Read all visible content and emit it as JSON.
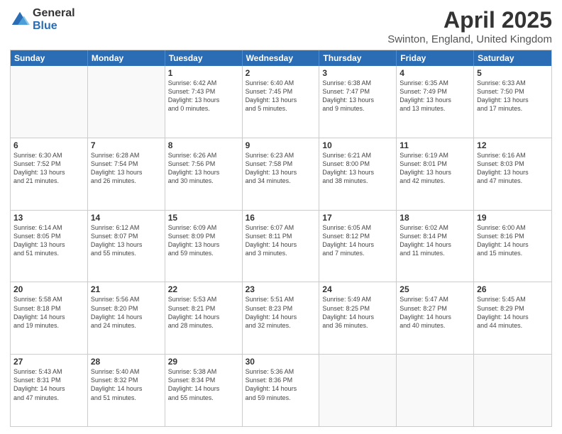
{
  "logo": {
    "general": "General",
    "blue": "Blue"
  },
  "header": {
    "month": "April 2025",
    "location": "Swinton, England, United Kingdom"
  },
  "days_of_week": [
    "Sunday",
    "Monday",
    "Tuesday",
    "Wednesday",
    "Thursday",
    "Friday",
    "Saturday"
  ],
  "weeks": [
    [
      {
        "day": "",
        "info": ""
      },
      {
        "day": "",
        "info": ""
      },
      {
        "day": "1",
        "info": "Sunrise: 6:42 AM\nSunset: 7:43 PM\nDaylight: 13 hours\nand 0 minutes."
      },
      {
        "day": "2",
        "info": "Sunrise: 6:40 AM\nSunset: 7:45 PM\nDaylight: 13 hours\nand 5 minutes."
      },
      {
        "day": "3",
        "info": "Sunrise: 6:38 AM\nSunset: 7:47 PM\nDaylight: 13 hours\nand 9 minutes."
      },
      {
        "day": "4",
        "info": "Sunrise: 6:35 AM\nSunset: 7:49 PM\nDaylight: 13 hours\nand 13 minutes."
      },
      {
        "day": "5",
        "info": "Sunrise: 6:33 AM\nSunset: 7:50 PM\nDaylight: 13 hours\nand 17 minutes."
      }
    ],
    [
      {
        "day": "6",
        "info": "Sunrise: 6:30 AM\nSunset: 7:52 PM\nDaylight: 13 hours\nand 21 minutes."
      },
      {
        "day": "7",
        "info": "Sunrise: 6:28 AM\nSunset: 7:54 PM\nDaylight: 13 hours\nand 26 minutes."
      },
      {
        "day": "8",
        "info": "Sunrise: 6:26 AM\nSunset: 7:56 PM\nDaylight: 13 hours\nand 30 minutes."
      },
      {
        "day": "9",
        "info": "Sunrise: 6:23 AM\nSunset: 7:58 PM\nDaylight: 13 hours\nand 34 minutes."
      },
      {
        "day": "10",
        "info": "Sunrise: 6:21 AM\nSunset: 8:00 PM\nDaylight: 13 hours\nand 38 minutes."
      },
      {
        "day": "11",
        "info": "Sunrise: 6:19 AM\nSunset: 8:01 PM\nDaylight: 13 hours\nand 42 minutes."
      },
      {
        "day": "12",
        "info": "Sunrise: 6:16 AM\nSunset: 8:03 PM\nDaylight: 13 hours\nand 47 minutes."
      }
    ],
    [
      {
        "day": "13",
        "info": "Sunrise: 6:14 AM\nSunset: 8:05 PM\nDaylight: 13 hours\nand 51 minutes."
      },
      {
        "day": "14",
        "info": "Sunrise: 6:12 AM\nSunset: 8:07 PM\nDaylight: 13 hours\nand 55 minutes."
      },
      {
        "day": "15",
        "info": "Sunrise: 6:09 AM\nSunset: 8:09 PM\nDaylight: 13 hours\nand 59 minutes."
      },
      {
        "day": "16",
        "info": "Sunrise: 6:07 AM\nSunset: 8:11 PM\nDaylight: 14 hours\nand 3 minutes."
      },
      {
        "day": "17",
        "info": "Sunrise: 6:05 AM\nSunset: 8:12 PM\nDaylight: 14 hours\nand 7 minutes."
      },
      {
        "day": "18",
        "info": "Sunrise: 6:02 AM\nSunset: 8:14 PM\nDaylight: 14 hours\nand 11 minutes."
      },
      {
        "day": "19",
        "info": "Sunrise: 6:00 AM\nSunset: 8:16 PM\nDaylight: 14 hours\nand 15 minutes."
      }
    ],
    [
      {
        "day": "20",
        "info": "Sunrise: 5:58 AM\nSunset: 8:18 PM\nDaylight: 14 hours\nand 19 minutes."
      },
      {
        "day": "21",
        "info": "Sunrise: 5:56 AM\nSunset: 8:20 PM\nDaylight: 14 hours\nand 24 minutes."
      },
      {
        "day": "22",
        "info": "Sunrise: 5:53 AM\nSunset: 8:21 PM\nDaylight: 14 hours\nand 28 minutes."
      },
      {
        "day": "23",
        "info": "Sunrise: 5:51 AM\nSunset: 8:23 PM\nDaylight: 14 hours\nand 32 minutes."
      },
      {
        "day": "24",
        "info": "Sunrise: 5:49 AM\nSunset: 8:25 PM\nDaylight: 14 hours\nand 36 minutes."
      },
      {
        "day": "25",
        "info": "Sunrise: 5:47 AM\nSunset: 8:27 PM\nDaylight: 14 hours\nand 40 minutes."
      },
      {
        "day": "26",
        "info": "Sunrise: 5:45 AM\nSunset: 8:29 PM\nDaylight: 14 hours\nand 44 minutes."
      }
    ],
    [
      {
        "day": "27",
        "info": "Sunrise: 5:43 AM\nSunset: 8:31 PM\nDaylight: 14 hours\nand 47 minutes."
      },
      {
        "day": "28",
        "info": "Sunrise: 5:40 AM\nSunset: 8:32 PM\nDaylight: 14 hours\nand 51 minutes."
      },
      {
        "day": "29",
        "info": "Sunrise: 5:38 AM\nSunset: 8:34 PM\nDaylight: 14 hours\nand 55 minutes."
      },
      {
        "day": "30",
        "info": "Sunrise: 5:36 AM\nSunset: 8:36 PM\nDaylight: 14 hours\nand 59 minutes."
      },
      {
        "day": "",
        "info": ""
      },
      {
        "day": "",
        "info": ""
      },
      {
        "day": "",
        "info": ""
      }
    ]
  ]
}
